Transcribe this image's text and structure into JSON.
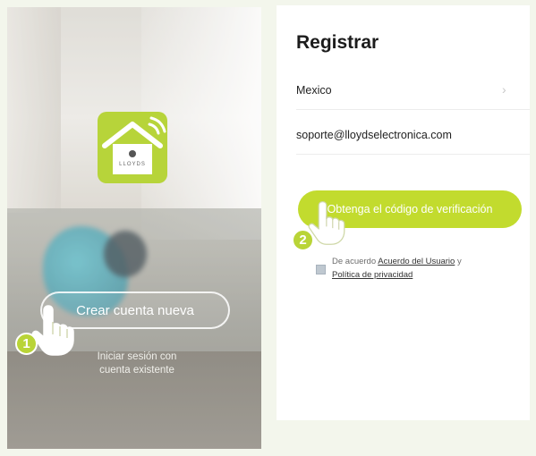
{
  "left_screen": {
    "logo_brand": "LLOYDS",
    "create_account_label": "Crear cuenta nueva",
    "login_line1": "Iniciar sesión con",
    "login_line2": "cuenta existente"
  },
  "right_screen": {
    "title": "Registrar",
    "country": "Mexico",
    "email": "soporte@lloydselectronica.com",
    "verify_button_label": "Obtenga el código de verificación",
    "agreement_prefix": "De acuerdo",
    "user_agreement_link": "Acuerdo del Usuario",
    "agreement_joiner": "y",
    "privacy_policy_link": "Política de privacidad",
    "agreement_checked": true
  },
  "steps": {
    "step1": "1",
    "step2": "2"
  },
  "colors": {
    "accent": "#c2db2e",
    "logo_green": "#b7d43a"
  },
  "icons": {
    "pointer": "hand-pointer-icon",
    "chevron": "chevron-right-icon",
    "wifi": "wifi-icon"
  }
}
